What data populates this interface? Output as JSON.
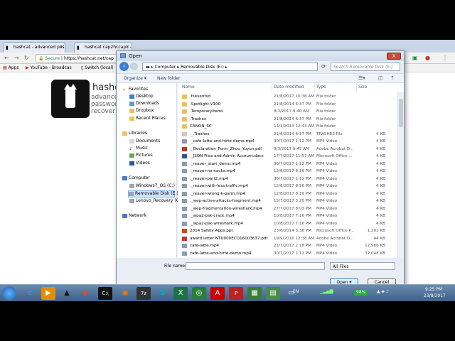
{
  "browser": {
    "tabs": [
      {
        "label": "hashcat - advanced pas"
      },
      {
        "label": "hashcat cap2hccapx - "
      }
    ],
    "secure_label": "Secure",
    "url": "https://hashcat.net/cap",
    "bookmarks": [
      {
        "label": "Apps"
      },
      {
        "label": "YouTube - Broadcas"
      },
      {
        "label": "Switch (local)"
      }
    ]
  },
  "page": {
    "title": "hashc",
    "subtitle_lines": [
      "advance",
      "passwor",
      "recover"
    ]
  },
  "dialog": {
    "title": "Open",
    "close_label": "X",
    "address": {
      "parts": [
        "Computer",
        "Removable Disk (E:)"
      ]
    },
    "search_placeholder": "Search Removable Disk (E:)",
    "toolbar": {
      "organize": "Organize ▾",
      "new_folder": "New folder"
    },
    "nav": {
      "favorites": "Favorites",
      "desktop": "Desktop",
      "downloads": "Downloads",
      "dropbox": "Dropbox",
      "recent": "Recent Places",
      "libraries": "Libraries",
      "documents": "Documents",
      "music": "Music",
      "pictures": "Pictures",
      "videos": "Videos",
      "computer": "Computer",
      "windows": "Windows7_OS (C:)",
      "removable": "Removable Disk (E:)",
      "lenovo": "Lenovo_Recovery (C",
      "network": "Network"
    },
    "columns": {
      "name": "Name",
      "date": "Date modified",
      "type": "Type",
      "size": "Size"
    },
    "files": [
      {
        "name": ".fseventsd",
        "date": "21/8/2017 10:38 AM",
        "type": "File folder",
        "size": "",
        "kind": "folder"
      },
      {
        "name": ".Spotlight-V100",
        "date": "21/8/2014 6:37 PM",
        "type": "File folder",
        "size": "",
        "kind": "folder"
      },
      {
        "name": ".TemporaryItems",
        "date": "8/3/2017 9:40 AM",
        "type": "File folder",
        "size": "",
        "kind": "folder"
      },
      {
        "name": ".Trashes",
        "date": "21/8/2014 6:37 PM",
        "type": "File folder",
        "size": "",
        "kind": "folder"
      },
      {
        "name": "CANON_SC",
        "date": "14/2/2013 12:43 AM",
        "type": "File folder",
        "size": "",
        "kind": "folder"
      },
      {
        "name": "._.Trashes",
        "date": "21/8/2014 6:37 PM",
        "type": "TRASHES File",
        "size": "4 KB",
        "kind": "file"
      },
      {
        "name": "._cafe-latte-and-hirte-demo.mp4",
        "date": "30/7/2017 1:12 PM",
        "type": "MP4 Video",
        "size": "4 KB",
        "kind": "video"
      },
      {
        "name": "._Declaration_Form_Zhou_Yuyun.pdf",
        "date": "8/3/2017 9:45 AM",
        "type": "Adobe Acrobat D...",
        "size": "4 KB",
        "kind": "pdf"
      },
      {
        "name": "._JSON Files and Admin Account.docx",
        "date": "17/7/2017 11:57 AM",
        "type": "Microsoft Office ...",
        "size": "4 KB",
        "kind": "doc"
      },
      {
        "name": "._reaver_start_demo.mp4",
        "date": "30/7/2017 1:12 PM",
        "type": "MP4 Video",
        "size": "4 KB",
        "kind": "video"
      },
      {
        "name": "._reaver-no-nacks.mp4",
        "date": "12/8/2017 8:16 PM",
        "type": "MP4 Video",
        "size": "4 KB",
        "kind": "video"
      },
      {
        "name": "._reaver-part2.mp4",
        "date": "30/7/2017 1:12 PM",
        "type": "MP4 Video",
        "size": "4 KB",
        "kind": "video"
      },
      {
        "name": "._reaver-with-less-traffic.mp4",
        "date": "12/8/2017 8:16 PM",
        "type": "MP4 Video",
        "size": "4 KB",
        "kind": "video"
      },
      {
        "name": "._reaver-wrong-k-parm.mp4",
        "date": "12/8/2017 8:16 PM",
        "type": "MP4 Video",
        "size": "4 KB",
        "kind": "video"
      },
      {
        "name": "._wep-active-attacks-fragment.mp4",
        "date": "15/7/2017 3:20 PM",
        "type": "MP4 Video",
        "size": "4 KB",
        "kind": "video"
      },
      {
        "name": "._wep-fragmentation-wireshark.mp4",
        "date": "27/7/2017 8:03 PM",
        "type": "MP4 Video",
        "size": "4 KB",
        "kind": "video"
      },
      {
        "name": "._wpa2-psk-crack.mp4",
        "date": "10/8/2017 7:16 PM",
        "type": "MP4 Video",
        "size": "4 KB",
        "kind": "video"
      },
      {
        "name": "._wpa2-psk-wireshark.mp4",
        "date": "10/8/2017 7:16 PM",
        "type": "MP4 Video",
        "size": "4 KB",
        "kind": "video"
      },
      {
        "name": "2014 Safety Apps.ppt",
        "date": "23/6/2014 3:38 PM",
        "type": "Microsoft Office P...",
        "size": "1,201 KB",
        "kind": "ppt"
      },
      {
        "name": "award letter NTU000ECO16003637.pdf",
        "date": "19/9/2016 12:38 AM",
        "type": "Adobe Acrobat D...",
        "size": "44 KB",
        "kind": "pdf"
      },
      {
        "name": "cafe-latte.mp4",
        "date": "21/7/2017 2:18 PM",
        "type": "MP4 Video",
        "size": "17,966 KB",
        "kind": "video"
      },
      {
        "name": "cafe-latte-and-hirte-demo.mp4",
        "date": "30/7/2017 1:12 PM",
        "type": "MP4 Video",
        "size": "32,048 KB",
        "kind": "video"
      }
    ],
    "filename_label": "File name:",
    "filename_value": "",
    "filetype_value": "All Files",
    "open_label": "Open",
    "cancel_label": "Cancel"
  },
  "taskbar": {
    "lang": "EN",
    "battery": "98%",
    "time": "9:25 PM",
    "date": "23/8/2017"
  },
  "colors": {
    "folder": "#e8c15a",
    "video": "#8d9bb0",
    "pdf": "#c0392b",
    "doc": "#2b5797",
    "ppt": "#d04a02",
    "file": "#c8c8c8"
  }
}
